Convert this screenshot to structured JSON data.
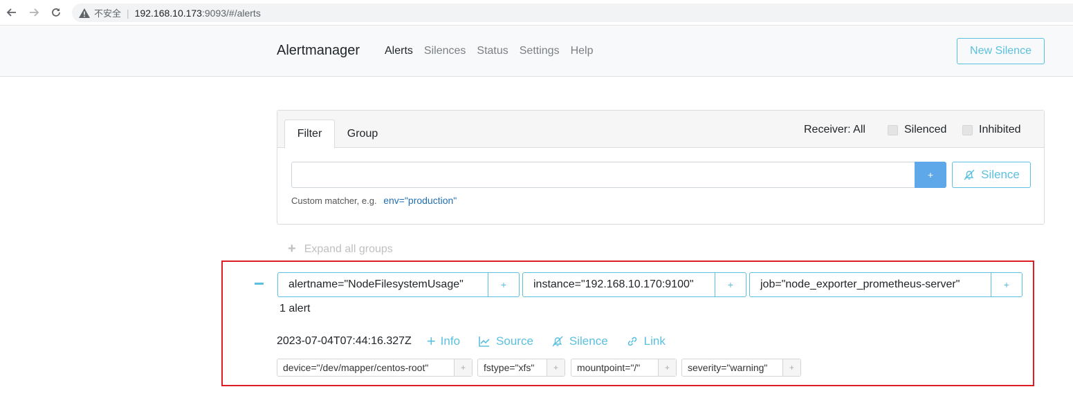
{
  "browser": {
    "insecure_label": "不安全",
    "separator": "|",
    "url_host": "192.168.10.173",
    "url_rest": ":9093/#/alerts"
  },
  "navbar": {
    "brand": "Alertmanager",
    "links": [
      "Alerts",
      "Silences",
      "Status",
      "Settings",
      "Help"
    ],
    "active": "Alerts",
    "new_silence_label": "New Silence"
  },
  "filter_card": {
    "tabs": [
      "Filter",
      "Group"
    ],
    "receiver_label": "Receiver: All",
    "silenced_label": "Silenced",
    "inhibited_label": "Inhibited",
    "input_value": "",
    "add_button_label": "+",
    "silence_button_label": "Silence",
    "hint_text": "Custom matcher, e.g.",
    "hint_example": "env=\"production\""
  },
  "expand_all": {
    "icon": "+",
    "label": "Expand all groups"
  },
  "alert_group": {
    "collapse_icon": "minus-icon",
    "labels": [
      "alertname=\"NodeFilesystemUsage\"",
      "instance=\"192.168.10.170:9100\"",
      "job=\"node_exporter_prometheus-server\""
    ],
    "plus": "+",
    "alert_count": "1 alert",
    "alert": {
      "timestamp": "2023-07-04T07:44:16.327Z",
      "actions": [
        "Info",
        "Source",
        "Silence",
        "Link"
      ],
      "info_prefix": "+",
      "labels": [
        "device=\"/dev/mapper/centos-root\"",
        "fstype=\"xfs\"",
        "mountpoint=\"/\"",
        "severity=\"warning\""
      ]
    }
  },
  "colors": {
    "accent": "#5bc0de",
    "primary_button": "#5ea7e8",
    "highlight": "#e11b22"
  }
}
